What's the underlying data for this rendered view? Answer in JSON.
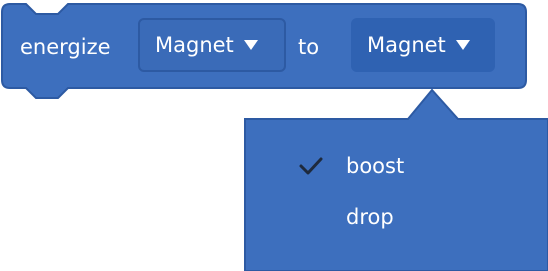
{
  "block": {
    "keyword": "energize",
    "connector": "to",
    "first_dropdown": {
      "value": "Magnet",
      "arrow_icon": "triangle-down-icon"
    },
    "second_dropdown": {
      "value": "Magnet",
      "arrow_icon": "triangle-down-icon"
    },
    "color": "#3d6fbe",
    "border_color": "#2d5aa3"
  },
  "menu": {
    "color": "#3d6fbe",
    "items": [
      {
        "label": "boost",
        "checked": true
      },
      {
        "label": "drop",
        "checked": false
      }
    ]
  }
}
